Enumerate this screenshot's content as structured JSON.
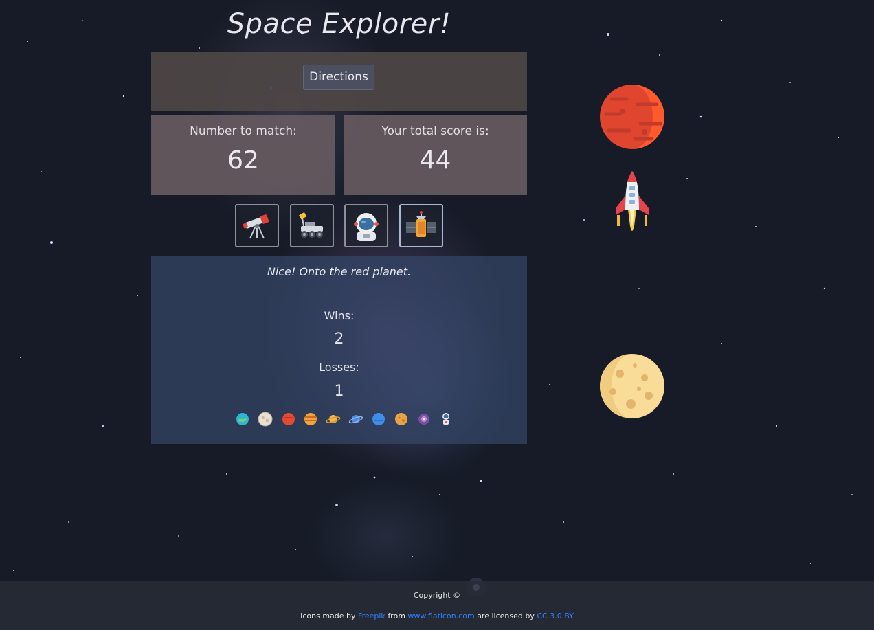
{
  "app": {
    "title": "Space Explorer!",
    "directions_label": "Directions"
  },
  "scoreboard": {
    "target_label": "Number to match:",
    "target_value": "62",
    "total_label": "Your total score is:",
    "total_value": "44"
  },
  "crystals": [
    {
      "icon": "telescope-icon"
    },
    {
      "icon": "moon-rover-icon"
    },
    {
      "icon": "astronaut-icon"
    },
    {
      "icon": "satellite-icon"
    }
  ],
  "result": {
    "message": "Nice! Onto the red planet.",
    "wins_label": "Wins:",
    "wins_value": "2",
    "losses_label": "Losses:",
    "losses_value": "1"
  },
  "progress_icons": [
    "earth-icon",
    "moon-icon",
    "mars-icon",
    "jupiter-icon",
    "saturn-icon",
    "uranus-icon",
    "neptune-icon",
    "pluto-icon",
    "galaxy-icon",
    "astronaut-icon"
  ],
  "side_icons": [
    "mars-planet-icon",
    "rocket-icon",
    "moon-planet-icon"
  ],
  "footer": {
    "copyright": "Copyright ©",
    "credits_prefix": "Icons made by",
    "author_link": "Freepik",
    "credits_from": "from",
    "site_link": "www.flaticon.com",
    "credits_licensed": "are licensed by",
    "license_link": "CC 3.0 BY"
  },
  "colors": {
    "background": "#161b27",
    "panel_directions": "#4e4646",
    "panel_score": "#665a60",
    "panel_result": "#344668",
    "link": "#2f7fff"
  }
}
